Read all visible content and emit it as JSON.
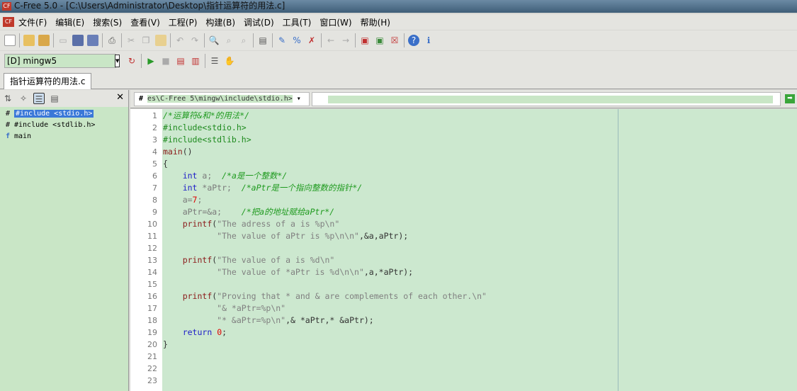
{
  "window": {
    "title": "C-Free 5.0 - [C:\\Users\\Administrator\\Desktop\\指针运算符的用法.c]"
  },
  "menu": [
    "文件(F)",
    "编辑(E)",
    "搜索(S)",
    "查看(V)",
    "工程(P)",
    "构建(B)",
    "调试(D)",
    "工具(T)",
    "窗口(W)",
    "帮助(H)"
  ],
  "toolbar": {
    "compiler": "[D] mingw5"
  },
  "tab": {
    "label": "指针运算符的用法.c"
  },
  "outline": {
    "items": [
      "#include <stdio.h>",
      "#include <stdlib.h>",
      "main"
    ]
  },
  "editor_header": {
    "path": "es\\C-Free 5\\mingw\\include\\stdio.h>"
  },
  "code": [
    [
      [
        "c",
        "/*运算符&和*的用法*/"
      ]
    ],
    [
      [
        "pp",
        "#include<stdio.h>"
      ]
    ],
    [
      [
        "pp",
        "#include<stdlib.h>"
      ]
    ],
    [
      [
        "fn",
        "main"
      ],
      [
        "p",
        "()"
      ]
    ],
    [
      [
        "p",
        "{"
      ]
    ],
    [
      [
        "p",
        "    "
      ],
      [
        "kw",
        "int"
      ],
      [
        "id",
        " a;  "
      ],
      [
        "c",
        "/*a是一个整数*/"
      ]
    ],
    [
      [
        "p",
        "    "
      ],
      [
        "kw",
        "int"
      ],
      [
        "id",
        " *aPtr;  "
      ],
      [
        "c",
        "/*aPtr是一个指向整数的指针*/"
      ]
    ],
    [
      [
        "id",
        "    a="
      ],
      [
        "num",
        "7"
      ],
      [
        "id",
        ";"
      ]
    ],
    [
      [
        "id",
        "    aPtr=&a;    "
      ],
      [
        "c",
        "/*把a的地址赋给aPtr*/"
      ]
    ],
    [
      [
        "p",
        "    "
      ],
      [
        "fn",
        "printf"
      ],
      [
        "p",
        "("
      ],
      [
        "s",
        "\"The adress of a is %p\\n\""
      ]
    ],
    [
      [
        "s",
        "           \"The value of aPtr is %p\\n\\n\""
      ],
      [
        "p",
        ",&a,aPtr);"
      ]
    ],
    [],
    [
      [
        "p",
        "    "
      ],
      [
        "fn",
        "printf"
      ],
      [
        "p",
        "("
      ],
      [
        "s",
        "\"The value of a is %d\\n\""
      ]
    ],
    [
      [
        "s",
        "           \"The value of *aPtr is %d\\n\\n\""
      ],
      [
        "p",
        ",a,*aPtr);"
      ]
    ],
    [],
    [
      [
        "p",
        "    "
      ],
      [
        "fn",
        "printf"
      ],
      [
        "p",
        "("
      ],
      [
        "s",
        "\"Proving that * and & are complements of each other.\\n\""
      ]
    ],
    [
      [
        "s",
        "           \"& *aPtr=%p\\n\""
      ]
    ],
    [
      [
        "s",
        "           \"* &aPtr=%p\\n\""
      ],
      [
        "p",
        ",& *aPtr,* &aPtr);"
      ]
    ],
    [
      [
        "p",
        "    "
      ],
      [
        "kw",
        "return"
      ],
      [
        "p",
        " "
      ],
      [
        "num",
        "0"
      ],
      [
        "p",
        ";"
      ]
    ],
    [
      [
        "p",
        "}"
      ]
    ],
    [],
    [],
    []
  ]
}
